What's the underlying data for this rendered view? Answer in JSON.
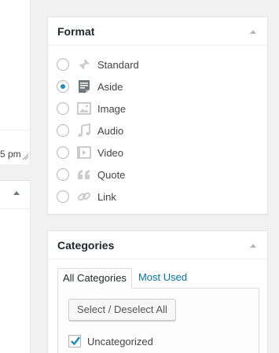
{
  "left_panel": {
    "time_fragment": "5 pm"
  },
  "format_box": {
    "title": "Format",
    "options": [
      {
        "label": "Standard",
        "icon": "pushpin-icon",
        "checked": false
      },
      {
        "label": "Aside",
        "icon": "aside-icon",
        "checked": true
      },
      {
        "label": "Image",
        "icon": "image-icon",
        "checked": false
      },
      {
        "label": "Audio",
        "icon": "music-note-icon",
        "checked": false
      },
      {
        "label": "Video",
        "icon": "video-icon",
        "checked": false
      },
      {
        "label": "Quote",
        "icon": "quote-icon",
        "checked": false
      },
      {
        "label": "Link",
        "icon": "link-icon",
        "checked": false
      }
    ]
  },
  "categories_box": {
    "title": "Categories",
    "tabs": [
      "All Categories",
      "Most Used"
    ],
    "select_button": "Select / Deselect All",
    "items": [
      {
        "label": "Uncategorized",
        "checked": true
      }
    ]
  },
  "colors": {
    "accent": "#1e8cbe",
    "link": "#0073aa",
    "icon_gray": "#cccccc",
    "icon_dark": "#72777c"
  }
}
